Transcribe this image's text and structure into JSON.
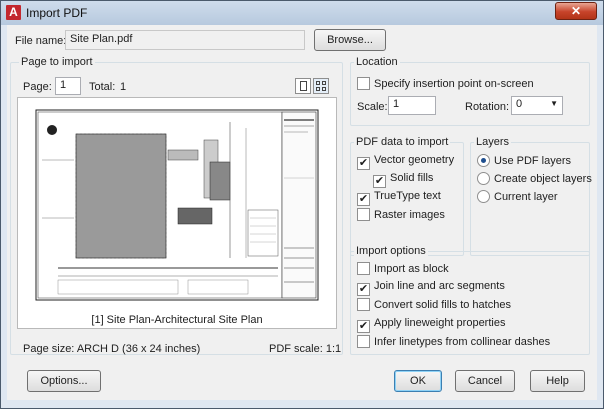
{
  "window": {
    "title": "Import PDF",
    "app_icon_letter": "A"
  },
  "file": {
    "label": "File name:",
    "value": "Site Plan.pdf",
    "browse_label": "Browse..."
  },
  "page_import": {
    "group_title": "Page to import",
    "page_label": "Page:",
    "page_value": "1",
    "total_label": "Total:",
    "total_value": "1",
    "preview_caption": "[1] Site Plan-Architectural Site Plan",
    "page_size": "Page size:  ARCH D (36 x 24 inches)",
    "pdf_scale": "PDF scale: 1:1"
  },
  "location": {
    "group_title": "Location",
    "specify_label": "Specify insertion point on-screen",
    "specify_checked": false,
    "scale_label": "Scale:",
    "scale_value": "1",
    "rotation_label": "Rotation:",
    "rotation_value": "0"
  },
  "pdf_data": {
    "group_title": "PDF data to import",
    "items": [
      {
        "label": "Vector geometry",
        "checked": true
      },
      {
        "label": "Solid fills",
        "checked": true
      },
      {
        "label": "TrueType text",
        "checked": true
      },
      {
        "label": "Raster images",
        "checked": false
      }
    ]
  },
  "layers": {
    "group_title": "Layers",
    "options": [
      {
        "label": "Use PDF layers",
        "selected": true
      },
      {
        "label": "Create object layers",
        "selected": false
      },
      {
        "label": "Current layer",
        "selected": false
      }
    ]
  },
  "import_options": {
    "group_title": "Import options",
    "items": [
      {
        "label": "Import as block",
        "checked": false
      },
      {
        "label": "Join line and arc segments",
        "checked": true
      },
      {
        "label": "Convert solid fills to hatches",
        "checked": false
      },
      {
        "label": "Apply lineweight properties",
        "checked": true
      },
      {
        "label": "Infer linetypes from collinear dashes",
        "checked": false
      }
    ]
  },
  "buttons": {
    "options": "Options...",
    "ok": "OK",
    "cancel": "Cancel",
    "help": "Help"
  },
  "colors": {
    "accent": "#3c7fb1",
    "title_bar": "#b7c9de",
    "close": "#c7432a",
    "check": "#1f4f8f"
  }
}
